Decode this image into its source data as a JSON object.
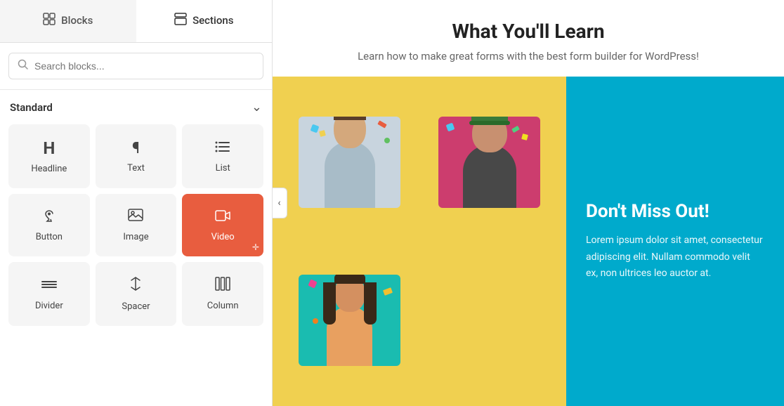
{
  "tabs": [
    {
      "id": "blocks",
      "label": "Blocks",
      "icon": "blocks-icon",
      "active": false
    },
    {
      "id": "sections",
      "label": "Sections",
      "icon": "sections-icon",
      "active": true
    }
  ],
  "search": {
    "placeholder": "Search blocks...",
    "value": ""
  },
  "standard_section": {
    "title": "Standard",
    "collapsed": false
  },
  "blocks": [
    {
      "id": "headline",
      "label": "Headline",
      "icon": "H",
      "active": false
    },
    {
      "id": "text",
      "label": "Text",
      "icon": "¶",
      "active": false
    },
    {
      "id": "list",
      "label": "List",
      "icon": "list",
      "active": false
    },
    {
      "id": "button",
      "label": "Button",
      "icon": "button",
      "active": false
    },
    {
      "id": "image",
      "label": "Image",
      "icon": "image",
      "active": false
    },
    {
      "id": "video",
      "label": "Video",
      "icon": "video",
      "active": true
    },
    {
      "id": "divider",
      "label": "Divider",
      "icon": "divider",
      "active": false
    },
    {
      "id": "spacer",
      "label": "Spacer",
      "icon": "spacer",
      "active": false
    },
    {
      "id": "column",
      "label": "Column",
      "icon": "column",
      "active": false
    }
  ],
  "content": {
    "heading": "What You'll Learn",
    "subtext": "Learn how to make great forms with the best form builder for WordPress!",
    "yellow_section": {
      "bg_color": "#f0d050"
    },
    "teal_section": {
      "bg_color": "#00aacc",
      "heading": "Don't Miss Out!",
      "body": "Lorem ipsum dolor sit amet, consectetur adipiscing elit. Nullam commodo velit ex, non ultrices leo auctor at."
    }
  },
  "colors": {
    "active_block_bg": "#e85d3f",
    "tab_active_bg": "#ffffff",
    "tab_inactive_bg": "#f5f5f5"
  }
}
